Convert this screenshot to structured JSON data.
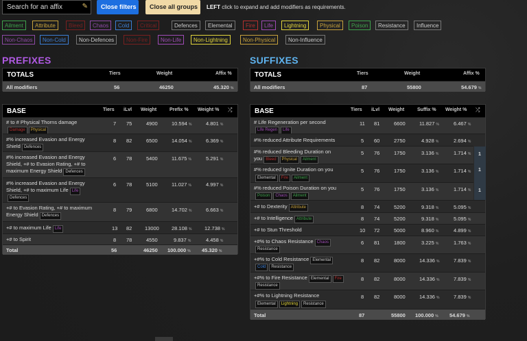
{
  "search": {
    "placeholder": "Search for an affix"
  },
  "buttons": {
    "close_filters": "Close filters",
    "close_all_groups": "Close all groups"
  },
  "hint": {
    "bold": "LEFT",
    "text": "click to expand and add modifiers as requirements."
  },
  "filters_row1": [
    "Ailment",
    "Attribute",
    "Bleed",
    "Chaos",
    "Cold",
    "Critical",
    "Defences",
    "Elemental",
    "Fire",
    "Life",
    "Lightning",
    "Physical",
    "Poison",
    "Resistance",
    "Influence"
  ],
  "filters_row2": [
    "Non-Chaos",
    "Non-Cold",
    "Non-Defences",
    "Non-Fire",
    "Non-Life",
    "Non-Lightning",
    "Non-Physical",
    "Non-Influence"
  ],
  "colors": {
    "ailment": "#3fa34d",
    "attribute": "#c8a23c",
    "chaos": "#a04cb7",
    "cold": "#3c7fd6",
    "fire": "#b5302e",
    "lightning": "#e4d63c",
    "physical": "#c8a23c",
    "poison": "#3fa34d",
    "prefix_title": "#b05ae3",
    "suffix_title": "#5fb4f0"
  },
  "prefixes": {
    "title": "PREFIXES",
    "totals": {
      "label": "TOTALS",
      "h_tiers": "Tiers",
      "h_weight": "Weight",
      "h_affix": "Affix %",
      "row_label": "All modifiers",
      "tiers": "56",
      "weight": "46250",
      "affix": "45.320",
      "pct": "%"
    },
    "base": {
      "label": "BASE",
      "headers": {
        "tiers": "Tiers",
        "ilvl": "iLvl",
        "weight": "Weight",
        "group": "Prefix %",
        "wpct": "Weight %"
      },
      "rows": [
        {
          "text1": "# to # Physical Thorns damage",
          "text2": "",
          "tags": [
            "Damage",
            "Physical"
          ],
          "tiers": "7",
          "ilvl": "75",
          "weight": "4900",
          "group": "10.594",
          "wpct": "4.801"
        },
        {
          "text1": "#% increased Evasion and Energy",
          "text2": "Shield",
          "tags": [
            "Defences"
          ],
          "tiers": "8",
          "ilvl": "82",
          "weight": "6500",
          "group": "14.054",
          "wpct": "6.369"
        },
        {
          "text1": "#% increased Evasion and Energy",
          "text2": "Shield, +# to Evasion Rating, +# to",
          "text3": "maximum Energy Shield",
          "tags": [
            "Defences"
          ],
          "tiers": "6",
          "ilvl": "78",
          "weight": "5400",
          "group": "11.675",
          "wpct": "5.291"
        },
        {
          "text1": "#% increased Evasion and Energy",
          "text2": "Shield, +# to maximum Life",
          "tags": [
            "Life",
            "Defences"
          ],
          "tiers": "6",
          "ilvl": "78",
          "weight": "5100",
          "group": "11.027",
          "wpct": "4.997"
        },
        {
          "text1": "+# to Evasion Rating, +# to maximum",
          "text2": "Energy Shield",
          "tags": [
            "Defences"
          ],
          "tiers": "8",
          "ilvl": "79",
          "weight": "6800",
          "group": "14.702",
          "wpct": "6.663"
        },
        {
          "text1": "+# to maximum Life",
          "text2": "",
          "tags": [
            "Life"
          ],
          "tiers": "13",
          "ilvl": "82",
          "weight": "13000",
          "group": "28.108",
          "wpct": "12.738"
        },
        {
          "text1": "+# to Spirit",
          "text2": "",
          "tags": [],
          "tiers": "8",
          "ilvl": "78",
          "weight": "4550",
          "group": "9.837",
          "wpct": "4.458"
        }
      ],
      "total": {
        "label": "Total",
        "tiers": "56",
        "weight": "46250",
        "group": "100.000",
        "wpct": "45.320"
      }
    }
  },
  "suffixes": {
    "title": "SUFFIXES",
    "totals": {
      "label": "TOTALS",
      "h_tiers": "Tiers",
      "h_weight": "Weight",
      "h_affix": "Affix %",
      "row_label": "All modifiers",
      "tiers": "87",
      "weight": "55800",
      "affix": "54.679",
      "pct": "%"
    },
    "base": {
      "label": "BASE",
      "headers": {
        "tiers": "Tiers",
        "ilvl": "iLvl",
        "weight": "Weight",
        "group": "Suffix %",
        "wpct": "Weight %"
      },
      "rows": [
        {
          "text1": "# Life Regeneration per second",
          "tags": [
            "Life Regen",
            "Life"
          ],
          "tiers": "11",
          "ilvl": "81",
          "weight": "6600",
          "group": "11.827",
          "wpct": "6.467",
          "side": ""
        },
        {
          "text1": "#% reduced Attribute Requirements",
          "tags": [],
          "tiers": "5",
          "ilvl": "60",
          "weight": "2750",
          "group": "4.928",
          "wpct": "2.694",
          "side": ""
        },
        {
          "text1": "#% reduced Bleeding Duration on",
          "text2": "you",
          "tags": [
            "Bleed",
            "Physical",
            "Ailment"
          ],
          "tiers": "5",
          "ilvl": "76",
          "weight": "1750",
          "group": "3.136",
          "wpct": "1.714",
          "side": "1"
        },
        {
          "text1": "#% reduced Ignite Duration on you",
          "tags": [
            "Elemental",
            "Fire",
            "Ailment"
          ],
          "tiers": "5",
          "ilvl": "76",
          "weight": "1750",
          "group": "3.136",
          "wpct": "1.714",
          "side": "1"
        },
        {
          "text1": "#% reduced Poison Duration on you",
          "tags": [
            "Poison",
            "Chaos",
            "Ailment"
          ],
          "tiers": "5",
          "ilvl": "76",
          "weight": "1750",
          "group": "3.136",
          "wpct": "1.714",
          "side": "1"
        },
        {
          "text1": "+# to Dexterity",
          "tags": [
            "Attribute"
          ],
          "tiers": "8",
          "ilvl": "74",
          "weight": "5200",
          "group": "9.318",
          "wpct": "5.095",
          "side": ""
        },
        {
          "text1": "+# to Intelligence",
          "tags": [
            "Attribute"
          ],
          "tiers": "8",
          "ilvl": "74",
          "weight": "5200",
          "group": "9.318",
          "wpct": "5.095",
          "side": ""
        },
        {
          "text1": "+# to Stun Threshold",
          "tags": [],
          "tiers": "10",
          "ilvl": "72",
          "weight": "5000",
          "group": "8.960",
          "wpct": "4.899",
          "side": ""
        },
        {
          "text1": "+#% to Chaos Resistance",
          "tags": [
            "Chaos",
            "Resistance"
          ],
          "tiers": "6",
          "ilvl": "81",
          "weight": "1800",
          "group": "3.225",
          "wpct": "1.763",
          "side": ""
        },
        {
          "text1": "+#% to Cold Resistance",
          "tags": [
            "Elemental",
            "Cold",
            "Resistance"
          ],
          "tiers": "8",
          "ilvl": "82",
          "weight": "8000",
          "group": "14.336",
          "wpct": "7.839",
          "side": ""
        },
        {
          "text1": "+#% to Fire Resistance",
          "tags": [
            "Elemental",
            "Fire",
            "Resistance"
          ],
          "tiers": "8",
          "ilvl": "82",
          "weight": "8000",
          "group": "14.336",
          "wpct": "7.839",
          "side": ""
        },
        {
          "text1": "+#% to Lightning Resistance",
          "tags": [
            "Elemental",
            "Lightning",
            "Resistance"
          ],
          "tiers": "8",
          "ilvl": "82",
          "weight": "8000",
          "group": "14.336",
          "wpct": "7.839",
          "side": ""
        }
      ],
      "total": {
        "label": "Total",
        "tiers": "87",
        "weight": "55800",
        "group": "100.000",
        "wpct": "54.679"
      }
    }
  }
}
